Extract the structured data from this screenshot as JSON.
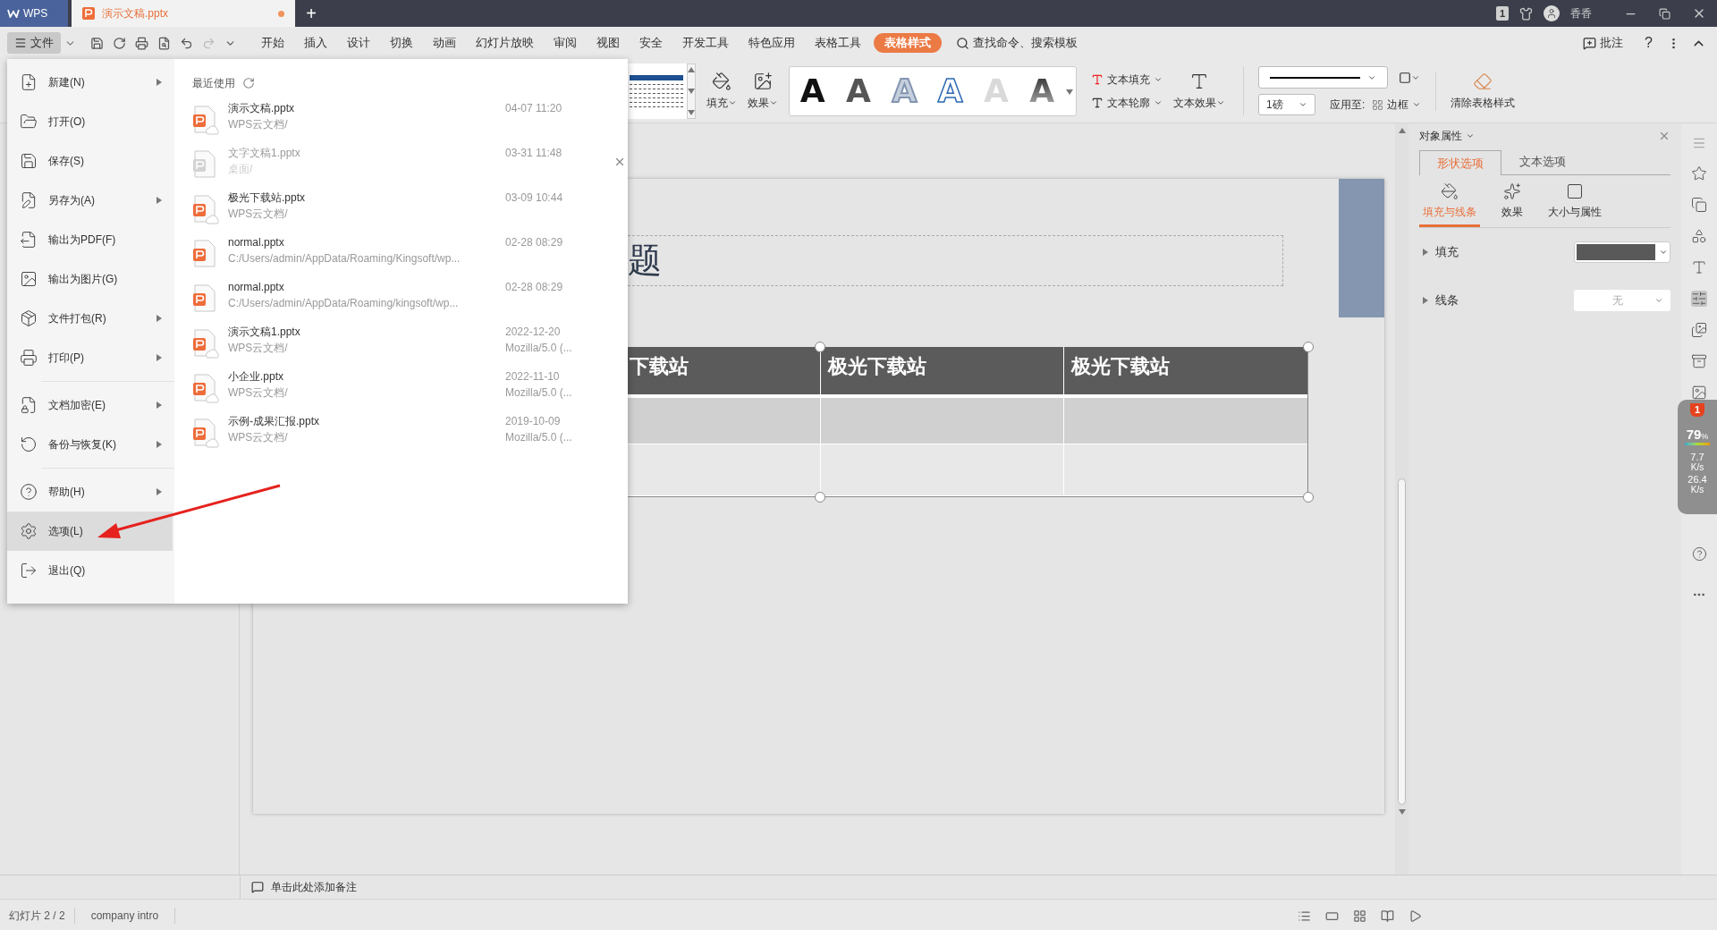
{
  "title_bar": {
    "tabs": [
      {
        "label": "WPS",
        "kind": "home",
        "selected": false
      },
      {
        "label": "演示文稿.pptx",
        "kind": "document",
        "selected": true,
        "unsaved": true
      }
    ],
    "new_tab": "+",
    "page_badge": "1",
    "user": "香香"
  },
  "menu_bar": {
    "file_button": "文件",
    "tabs": [
      {
        "label": "开始",
        "selected": false
      },
      {
        "label": "插入",
        "selected": false
      },
      {
        "label": "设计",
        "selected": false
      },
      {
        "label": "切换",
        "selected": false
      },
      {
        "label": "动画",
        "selected": false
      },
      {
        "label": "幻灯片放映",
        "selected": false
      },
      {
        "label": "审阅",
        "selected": false
      },
      {
        "label": "视图",
        "selected": false
      },
      {
        "label": "安全",
        "selected": false
      },
      {
        "label": "开发工具",
        "selected": false
      },
      {
        "label": "特色应用",
        "selected": false
      },
      {
        "label": "表格工具",
        "selected": false
      },
      {
        "label": "表格样式",
        "selected": true
      }
    ],
    "search": "查找命令、搜索模板",
    "comment": "批注",
    "help": "?"
  },
  "ribbon": {
    "fill": "填充",
    "effect": "效果",
    "wordart_styles": [
      {
        "letter": "A",
        "kind": "solid"
      },
      {
        "letter": "A",
        "kind": "gray"
      },
      {
        "letter": "A",
        "kind": "soft-outline"
      },
      {
        "letter": "A",
        "kind": "outline"
      },
      {
        "letter": "A",
        "kind": "faint"
      },
      {
        "letter": "A",
        "kind": "gradient"
      }
    ],
    "text_fill": "文本填充",
    "text_outline": "文本轮廓",
    "text_effect": "文本效果",
    "line_weight": "1磅",
    "apply_to": "应用至:",
    "border": "边框",
    "clear_style": "清除表格样式"
  },
  "file_menu": {
    "groups": [
      [
        {
          "label": "新建(N)",
          "submenu": true,
          "selected": false
        },
        {
          "label": "打开(O)",
          "submenu": false,
          "selected": false
        },
        {
          "label": "保存(S)",
          "submenu": false,
          "selected": false
        },
        {
          "label": "另存为(A)",
          "submenu": true,
          "selected": false
        },
        {
          "label": "输出为PDF(F)",
          "submenu": false,
          "selected": false
        },
        {
          "label": "输出为图片(G)",
          "submenu": false,
          "selected": false
        },
        {
          "label": "文件打包(R)",
          "submenu": true,
          "selected": false
        },
        {
          "label": "打印(P)",
          "submenu": true,
          "selected": false
        }
      ],
      [
        {
          "label": "文档加密(E)",
          "submenu": true,
          "selected": false
        },
        {
          "label": "备份与恢复(K)",
          "submenu": true,
          "selected": false
        }
      ],
      [
        {
          "label": "帮助(H)",
          "submenu": true,
          "selected": false
        },
        {
          "label": "选项(L)",
          "submenu": false,
          "selected": true
        },
        {
          "label": "退出(Q)",
          "submenu": false,
          "selected": false
        }
      ]
    ],
    "recent_title": "最近使用",
    "recent_files": [
      {
        "name": "演示文稿.pptx",
        "location": "WPS云文档/",
        "time": "04-07 11:20",
        "cloud": true,
        "available": true,
        "hovered": false
      },
      {
        "name": "文字文稿1.pptx",
        "location": "桌面/",
        "time": "03-31 11:48",
        "cloud": false,
        "available": false,
        "hovered": true
      },
      {
        "name": "极光下载站.pptx",
        "location": "WPS云文档/",
        "time": "03-09 10:44",
        "cloud": true,
        "available": true,
        "hovered": false
      },
      {
        "name": "normal.pptx",
        "location": "C:/Users/admin/AppData/Roaming/Kingsoft/wp...",
        "time": "02-28 08:29",
        "cloud": false,
        "available": true,
        "hovered": false
      },
      {
        "name": "normal.pptx",
        "location": "C:/Users/admin/AppData/Roaming/kingsoft/wp...",
        "time": "02-28 08:29",
        "cloud": false,
        "available": true,
        "hovered": false
      },
      {
        "name": "演示文稿1.pptx",
        "location": "WPS云文档/",
        "time": "2022-12-20",
        "detail": "Mozilla/5.0 (...",
        "cloud": true,
        "available": true,
        "hovered": false
      },
      {
        "name": "小企业.pptx",
        "location": "WPS云文档/",
        "time": "2022-11-10",
        "detail": "Mozilla/5.0 (...",
        "cloud": true,
        "available": true,
        "hovered": false
      },
      {
        "name": "示例-成果汇报.pptx",
        "location": "WPS云文档/",
        "time": "2019-10-09",
        "detail": "Mozilla/5.0 (...",
        "cloud": true,
        "available": true,
        "hovered": false
      }
    ]
  },
  "slide": {
    "title": "题",
    "table_header": [
      "下载站",
      "极光下载站",
      "极光下载站"
    ]
  },
  "notes_placeholder": "单击此处添加备注",
  "properties_panel": {
    "title": "对象属性",
    "tabs": [
      {
        "label": "形状选项",
        "selected": true
      },
      {
        "label": "文本选项",
        "selected": false
      }
    ],
    "subtabs": [
      {
        "label": "填充与线条",
        "selected": true
      },
      {
        "label": "效果",
        "selected": false
      },
      {
        "label": "大小与属性",
        "selected": false
      }
    ],
    "rows": [
      {
        "label": "填充",
        "kind": "color",
        "color": "#595959"
      },
      {
        "label": "线条",
        "kind": "none",
        "value": "无"
      }
    ]
  },
  "speed_widget": {
    "badge": "1",
    "percent": "79",
    "percent_unit": "%",
    "upload": "7.7",
    "upload_unit": "K/s",
    "download": "26.4",
    "download_unit": "K/s"
  },
  "status_bar": {
    "slide": "幻灯片 2 / 2",
    "theme": "company intro"
  }
}
